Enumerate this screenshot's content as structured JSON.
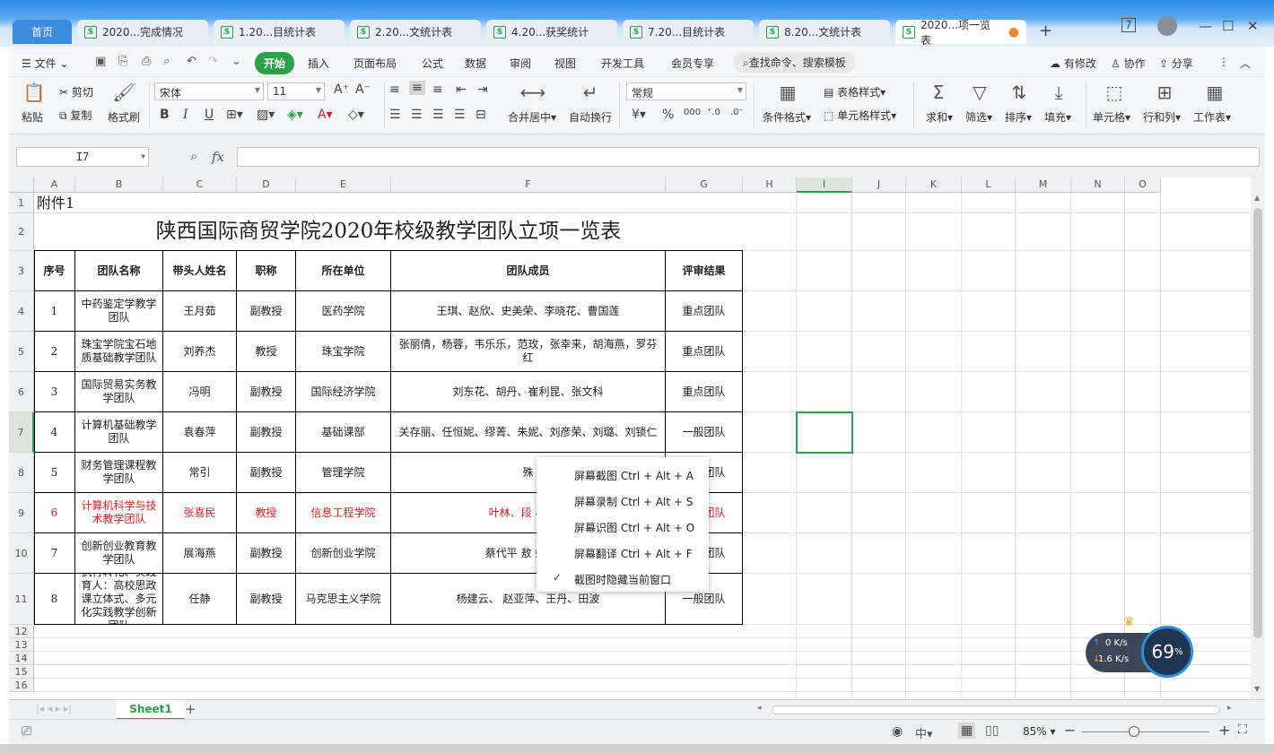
{
  "tabs": {
    "home": "首页",
    "files": [
      "2020...完成情况",
      "1.20...目统计表",
      "2.20...文统计表",
      "4.20...获奖统计",
      "7.20...目统计表",
      "8.20...文统计表"
    ],
    "active": "2020...项一览表"
  },
  "menu": {
    "file": "文件",
    "start": "开始",
    "insert": "插入",
    "page_layout": "页面布局",
    "formula": "公式",
    "data": "数据",
    "review": "审阅",
    "view": "视图",
    "dev_tools": "开发工具",
    "member": "会员专享",
    "search": "查找命令、搜索模板",
    "modified": "有修改",
    "collab": "协作",
    "share": "分享"
  },
  "ribbon": {
    "paste": "粘贴",
    "cut": "剪切",
    "copy": "复制",
    "format_painter": "格式刷",
    "font_name": "宋体",
    "font_size": "11",
    "merge": "合并居中",
    "wrap": "自动换行",
    "number_format": "常规",
    "cond_format": "条件格式",
    "table_style": "表格样式",
    "cell_style": "单元格样式",
    "sum": "求和",
    "filter": "筛选",
    "sort": "排序",
    "fill": "填充",
    "cell": "单元格",
    "rowcol": "行和列",
    "sheet": "工作表"
  },
  "formula_bar": {
    "name_box": "I7",
    "fx": "fx"
  },
  "columns": [
    "A",
    "B",
    "C",
    "D",
    "E",
    "F",
    "G",
    "H",
    "I",
    "J",
    "K",
    "L",
    "M",
    "N",
    "O"
  ],
  "rows": [
    "1",
    "2",
    "3",
    "4",
    "5",
    "6",
    "7",
    "8",
    "9",
    "10",
    "11",
    "12",
    "13",
    "14",
    "15",
    "16"
  ],
  "sheet": {
    "attachment": "附件1",
    "title": "陕西国际商贸学院2020年校级教学团队立项一览表",
    "headers": [
      "序号",
      "团队名称",
      "带头人姓名",
      "职称",
      "所在单位",
      "团队成员",
      "评审结果"
    ],
    "records": [
      [
        "1",
        "中药鉴定学教学团队",
        "王月茹",
        "副教授",
        "医药学院",
        "王琪、赵欣、史美荣、李晓花、曹国莲",
        "重点团队"
      ],
      [
        "2",
        "珠宝学院宝石地质基础教学团队",
        "刘养杰",
        "教授",
        "珠宝学院",
        "张丽倩，杨蓉，韦乐乐，范玫，张幸来，胡海燕，罗芬红",
        "重点团队"
      ],
      [
        "3",
        "国际贸易实务教学团队",
        "冯明",
        "副教授",
        "国际经济学院",
        "刘东花、胡丹、崔利昆、张文科",
        "重点团队"
      ],
      [
        "4",
        "计算机基础教学团队",
        "袁春萍",
        "副教授",
        "基础课部",
        "关存丽、任恒妮、缪菁、朱妮、刘彦荣、刘璐、刘锁仁",
        "一般团队"
      ],
      [
        "5",
        "财务管理课程教学团队",
        "常引",
        "副教授",
        "管理学院",
        "殊",
        "一般团队"
      ],
      [
        "6",
        "计算机科学与技术教学团队",
        "张喜民",
        "教授",
        "信息工程学院",
        "叶林、段 小菊、",
        "一般团队"
      ],
      [
        "7",
        "创新创业教育教学团队",
        "展海燕",
        "副教授",
        "创新创业学院",
        "蔡代平 敖 姣姣 郑",
        "一般团队"
      ],
      [
        "8",
        "执行转化、实践育人：高校思政课立体式、多元化实践教学创新团队",
        "任静",
        "副教授",
        "马克思主义学院",
        "杨建云、 赵亚萍、王丹、田波",
        "一般团队"
      ]
    ]
  },
  "context_menu": [
    "屏幕截图 Ctrl + Alt + A",
    "屏幕录制 Ctrl + Alt + S",
    "屏幕识图 Ctrl + Alt + O",
    "屏幕翻译 Ctrl + Alt + F",
    "截图时隐藏当前窗口"
  ],
  "sheet_tab": "Sheet1",
  "status": {
    "zoom": "85%"
  },
  "net": {
    "up": "0 K/s",
    "down": "1.6 K/s",
    "percent": "69",
    "unit": "%"
  }
}
